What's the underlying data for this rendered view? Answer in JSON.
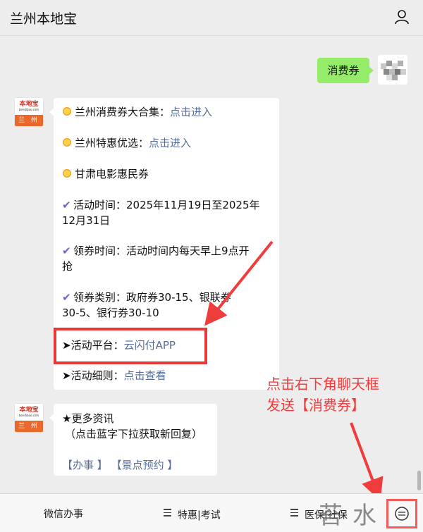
{
  "header": {
    "title": "兰州本地宝",
    "user_icon": "user-icon"
  },
  "outgoing": {
    "text": "消费券"
  },
  "logo": {
    "brand": "本地宝",
    "sub": "bendibao.com",
    "city": "兰 州"
  },
  "message1": {
    "lines": [
      {
        "text": "兰州消费券大合集：",
        "link": "点击进入"
      },
      {
        "text": "兰州特惠优选：",
        "link": "点击进入"
      },
      {
        "text": "甘肃电影惠民券"
      },
      {
        "text": "活动时间：2025年11月19日至2025年",
        "cont": "12月31日"
      },
      {
        "text": "领券时间：活动时间内每天早上9点开",
        "cont": "抢"
      },
      {
        "text": "领券类别：政府券30-15、银联券",
        "cont": "30-5、银行券30-10"
      },
      {
        "text": "➤活动平台：",
        "link": "云闪付APP"
      },
      {
        "text": "➤活动细则：",
        "link": "点击查看"
      }
    ]
  },
  "message2": {
    "line1": "★更多资讯",
    "line2": "（点击蓝字下拉获取新回复）",
    "links": [
      "【办事 】",
      "【景点预约 】"
    ]
  },
  "annotation": {
    "line1": "点击右下角聊天框",
    "line2": "发送【消费券】"
  },
  "footer": {
    "tabs": [
      "微信办事",
      "特惠|考试",
      "医保|社保"
    ]
  },
  "watermark": "苔水网",
  "colors": {
    "accent_red": "#e63a3a",
    "link": "#576b95",
    "bubble_green": "#95ec69"
  }
}
